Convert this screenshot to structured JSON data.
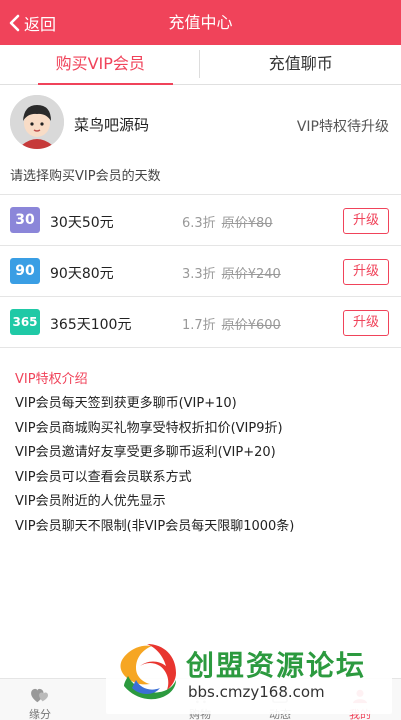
{
  "header": {
    "back_label": "返回",
    "title": "充值中心"
  },
  "tabs": [
    {
      "label": "购买VIP会员",
      "active": true
    },
    {
      "label": "充值聊币",
      "active": false
    }
  ],
  "profile": {
    "username": "菜鸟吧源码",
    "vip_status": "VIP特权待升级"
  },
  "hint": "请选择购买VIP会员的天数",
  "plans": [
    {
      "badge": "30",
      "badge_color": "#8b86d9",
      "label": "30天50元",
      "discount": "6.3折",
      "original_price": "原价¥80",
      "action": "升级"
    },
    {
      "badge": "90",
      "badge_color": "#3a9ee4",
      "label": "90天80元",
      "discount": "3.3折",
      "original_price": "原价¥240",
      "action": "升级"
    },
    {
      "badge": "365",
      "badge_color": "#1fc9a6",
      "label": "365天100元",
      "discount": "1.7折",
      "original_price": "原价¥600",
      "action": "升级"
    }
  ],
  "intro": {
    "title": "VIP特权介绍",
    "perks": [
      "VIP会员每天签到获更多聊币(VIP+10)",
      "VIP会员商城购买礼物享受特权折扣价(VIP9折)",
      "VIP会员邀请好友享受更多聊币返利(VIP+20)",
      "VIP会员可以查看会员联系方式",
      "VIP会员附近的人优先显示",
      "VIP会员聊天不限制(非VIP会员每天限聊1000条)"
    ]
  },
  "footer": {
    "tabs": [
      {
        "label": "缘分",
        "icon": "hearts-icon"
      },
      {
        "label": "购物",
        "icon": "cart-icon"
      },
      {
        "label": "动态",
        "icon": "feed-icon"
      },
      {
        "label": "我的",
        "icon": "user-icon"
      }
    ]
  },
  "watermark": {
    "title": "创盟资源论坛",
    "url": "bbs.cmzy168.com"
  },
  "colors": {
    "accent": "#f0435a",
    "watermark_green": "#2c9a3f"
  }
}
